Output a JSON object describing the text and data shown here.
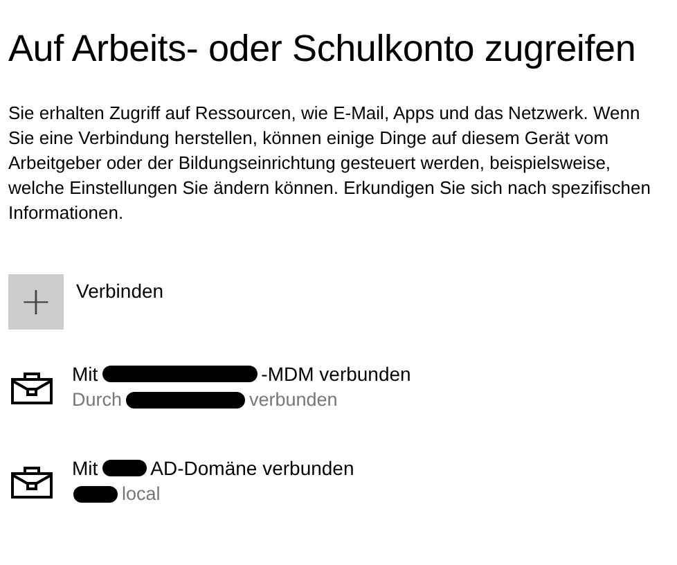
{
  "title": "Auf Arbeits- oder Schulkonto zugreifen",
  "description": "Sie erhalten Zugriff auf Ressourcen, wie E-Mail, Apps und das Netzwerk. Wenn Sie eine Verbindung herstellen, können einige Dinge auf diesem Gerät vom Arbeitgeber oder der Bildungseinrichtung gesteuert werden, beispielsweise, welche Einstellungen Sie ändern können. Erkundigen Sie sich nach spezifischen Informationen.",
  "connect_button": {
    "icon": "+",
    "label": "Verbinden"
  },
  "accounts": [
    {
      "title": [
        {
          "kind": "text",
          "text": "Mit"
        },
        {
          "kind": "redaction-long"
        },
        {
          "kind": "text",
          "text": "-MDM verbunden"
        }
      ],
      "subtitle": [
        {
          "kind": "text",
          "text": "Durch"
        },
        {
          "kind": "redaction-medium"
        },
        {
          "kind": "text",
          "text": "verbunden"
        }
      ]
    },
    {
      "title": [
        {
          "kind": "text",
          "text": "Mit"
        },
        {
          "kind": "redaction-short"
        },
        {
          "kind": "text",
          "text": "AD-Domäne verbunden"
        }
      ],
      "subtitle": [
        {
          "kind": "redaction-short"
        },
        {
          "kind": "text",
          "text": "local"
        }
      ]
    }
  ]
}
